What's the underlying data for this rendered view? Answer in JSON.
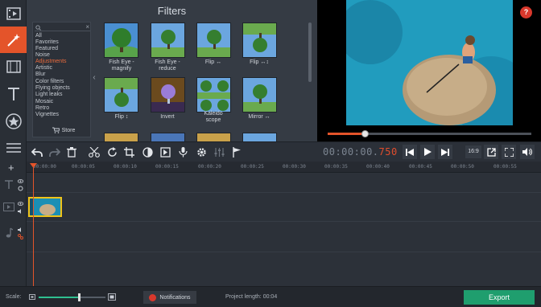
{
  "colors": {
    "accent": "#e4542a",
    "export": "#1f9e6e",
    "selected_category": "#ea6a3c",
    "clip_border": "#f0c419",
    "scale_fill": "#2fbf8f"
  },
  "sidebar": {
    "items": [
      {
        "name": "video-import",
        "icon": "film-import-icon"
      },
      {
        "name": "filters",
        "icon": "magic-wand-icon",
        "active": true
      },
      {
        "name": "transitions",
        "icon": "film-strip-icon"
      },
      {
        "name": "titles",
        "icon": "text-t-icon"
      },
      {
        "name": "stickers",
        "icon": "star-badge-icon"
      },
      {
        "name": "more",
        "icon": "list-icon"
      }
    ]
  },
  "filters": {
    "title": "Filters",
    "categories": [
      "All",
      "Favorites",
      "Featured",
      "Noise",
      "Adjustments",
      "Artistic",
      "Blur",
      "Color filters",
      "Flying objects",
      "Light leaks",
      "Mosaic",
      "Retro",
      "Vignettes"
    ],
    "selected_category": "Adjustments",
    "store_label": "Store",
    "items": [
      {
        "label": "Fish Eye -\nmagnify"
      },
      {
        "label": "Fish Eye -\nreduce"
      },
      {
        "label": "Flip ↔"
      },
      {
        "label": "Flip ↔↕"
      },
      {
        "label": "Flip ↕"
      },
      {
        "label": "Invert"
      },
      {
        "label": "Kaleido\nscope"
      },
      {
        "label": "Mirror ↔"
      }
    ]
  },
  "preview": {
    "help_label": "?",
    "seek_progress": 0.18
  },
  "toolbar": {
    "timecode_main": "00:00:00.",
    "timecode_ms": "750",
    "aspect_label": "16:9"
  },
  "timeline": {
    "ticks": [
      "00:00:00",
      "00:00:05",
      "00:00:10",
      "00:00:15",
      "00:00:20",
      "00:00:25",
      "00:00:30",
      "00:00:35",
      "00:00:40",
      "00:00:45",
      "00:00:50",
      "00:00:55"
    ]
  },
  "status": {
    "scale_label": "Scale:",
    "scale_value": 0.6,
    "notifications_label": "Notifications",
    "project_length_label": "Project length:  00:04",
    "export_label": "Export"
  }
}
